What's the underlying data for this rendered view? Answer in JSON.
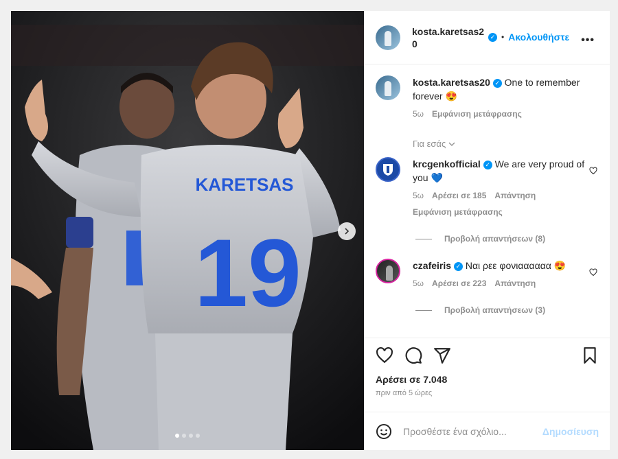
{
  "post": {
    "username": "kosta.karetsas20",
    "follow_label": "Ακολουθήστε",
    "dot_separator": "•",
    "more_label": "•••",
    "caption_user": "kosta.karetsas20",
    "caption_text": "One to remember forever 😍",
    "caption_time": "5ω",
    "caption_translate": "Εμφάνιση μετάφρασης",
    "for_you_label": "Για εσάς",
    "jersey_name": "KARETSAS",
    "jersey_number": "19",
    "carousel_dots": 4,
    "carousel_active": 0
  },
  "comments": [
    {
      "user": "krcgenkofficial",
      "text": "We are very proud of you 💙",
      "time": "5ω",
      "likes": "Αρέσει σε 185",
      "reply": "Απάντηση",
      "translate": "Εμφάνιση μετάφρασης",
      "view_replies": "Προβολή απαντήσεων (8)"
    },
    {
      "user": "czafeiris",
      "text": "Ναι ρεε φονιαααααα 😍",
      "time": "5ω",
      "likes": "Αρέσει σε 223",
      "reply": "Απάντηση",
      "view_replies": "Προβολή απαντήσεων (3)"
    }
  ],
  "footer": {
    "likes": "Αρέσει σε 7.048",
    "time": "πριν από 5 ώρες",
    "comment_placeholder": "Προσθέστε ένα σχόλιο...",
    "post_label": "Δημοσίευση"
  },
  "icons": [
    "heart-icon",
    "comment-icon",
    "share-icon",
    "bookmark-icon",
    "emoji-icon",
    "chevron-right-icon",
    "chevron-down-icon",
    "verified-icon"
  ],
  "colors": {
    "accent": "#0095f6",
    "jersey": "#c9ccd2",
    "number": "#2458d6",
    "background": "#111111"
  }
}
